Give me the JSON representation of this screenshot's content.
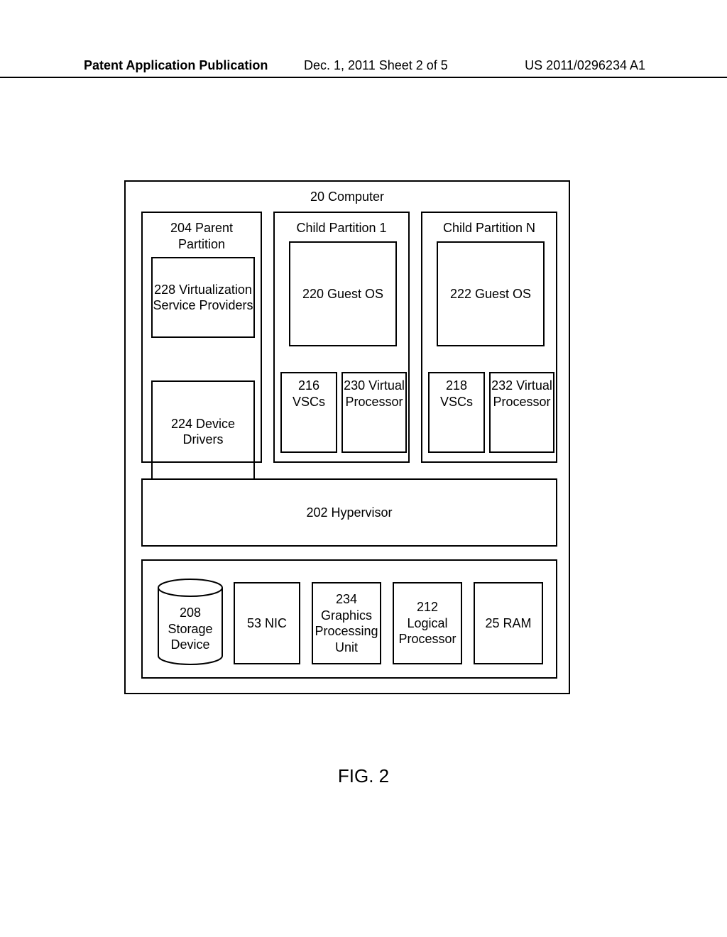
{
  "header": {
    "left": "Patent Application Publication",
    "center": "Dec. 1, 2011  Sheet 2 of 5",
    "right": "US 2011/0296234 A1"
  },
  "computer": {
    "title": "20 Computer",
    "parent": {
      "title": "204 Parent Partition",
      "vsp": "228 Virtualization Service Providers",
      "drivers": "224 Device Drivers"
    },
    "child1": {
      "title": "Child Partition 1",
      "guest": "220 Guest OS",
      "vscs": "216 VSCs",
      "vproc": "230 Virtual Processor"
    },
    "childN": {
      "title": "Child Partition N",
      "guest": "222 Guest OS",
      "vscs": "218 VSCs",
      "vproc": "232 Virtual Processor"
    },
    "hypervisor": "202 Hypervisor",
    "hw": {
      "storage": "208 Storage Device",
      "nic": "53 NIC",
      "gpu": "234 Graphics Processing Unit",
      "lproc": "212 Logical Processor",
      "ram": "25 RAM"
    }
  },
  "figure_caption": "FIG. 2"
}
